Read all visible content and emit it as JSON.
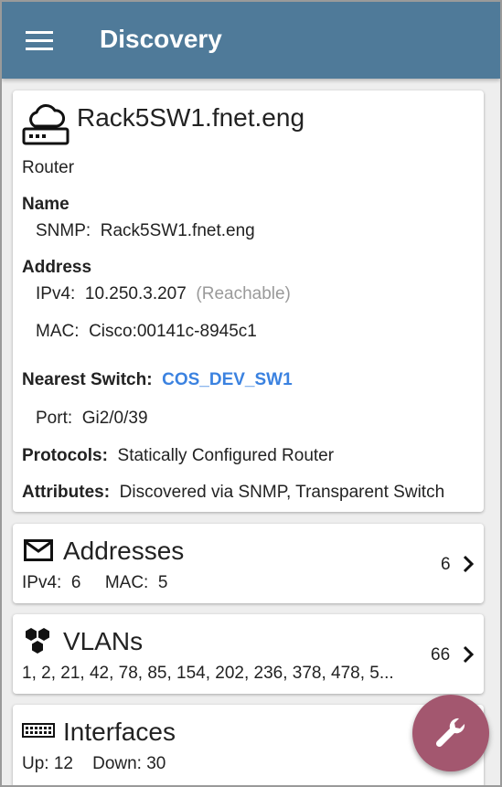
{
  "appbar": {
    "title": "Discovery",
    "menu_icon": "hamburger-menu-icon"
  },
  "device": {
    "name": "Rack5SW1.fnet.eng",
    "type": "Router",
    "icon": "router-cloud-icon",
    "name_section": {
      "label": "Name",
      "snmp_label": "SNMP:",
      "snmp_value": "Rack5SW1.fnet.eng"
    },
    "address_section": {
      "label": "Address",
      "ipv4_label": "IPv4:",
      "ipv4_value": "10.250.3.207",
      "ipv4_status": "(Reachable)",
      "mac_label": "MAC:",
      "mac_value": "Cisco:00141c-8945c1"
    },
    "nearest_switch": {
      "label": "Nearest Switch:",
      "value": "COS_DEV_SW1",
      "port_label": "Port:",
      "port_value": "Gi2/0/39"
    },
    "protocols": {
      "label": "Protocols:",
      "value": "Statically Configured Router"
    },
    "attributes": {
      "label": "Attributes:",
      "value": "Discovered via SNMP, Transparent Switch"
    }
  },
  "addresses": {
    "title": "Addresses",
    "icon": "envelope-icon",
    "summary": "IPv4:  6     MAC:  5",
    "count": "6"
  },
  "vlans": {
    "title": "VLANs",
    "icon": "hexagon-cluster-icon",
    "summary": "1, 2, 21, 42, 78, 85, 154, 202, 236, 378, 478, 5...",
    "count": "66"
  },
  "interfaces": {
    "title": "Interfaces",
    "icon": "switch-ports-icon",
    "summary": "Up: 12    Down: 30"
  },
  "fab": {
    "icon": "wrench-icon"
  },
  "colors": {
    "appbar": "#4f7a99",
    "link": "#3b82e0",
    "fab": "#a3576f",
    "muted": "#9a9a9a"
  }
}
